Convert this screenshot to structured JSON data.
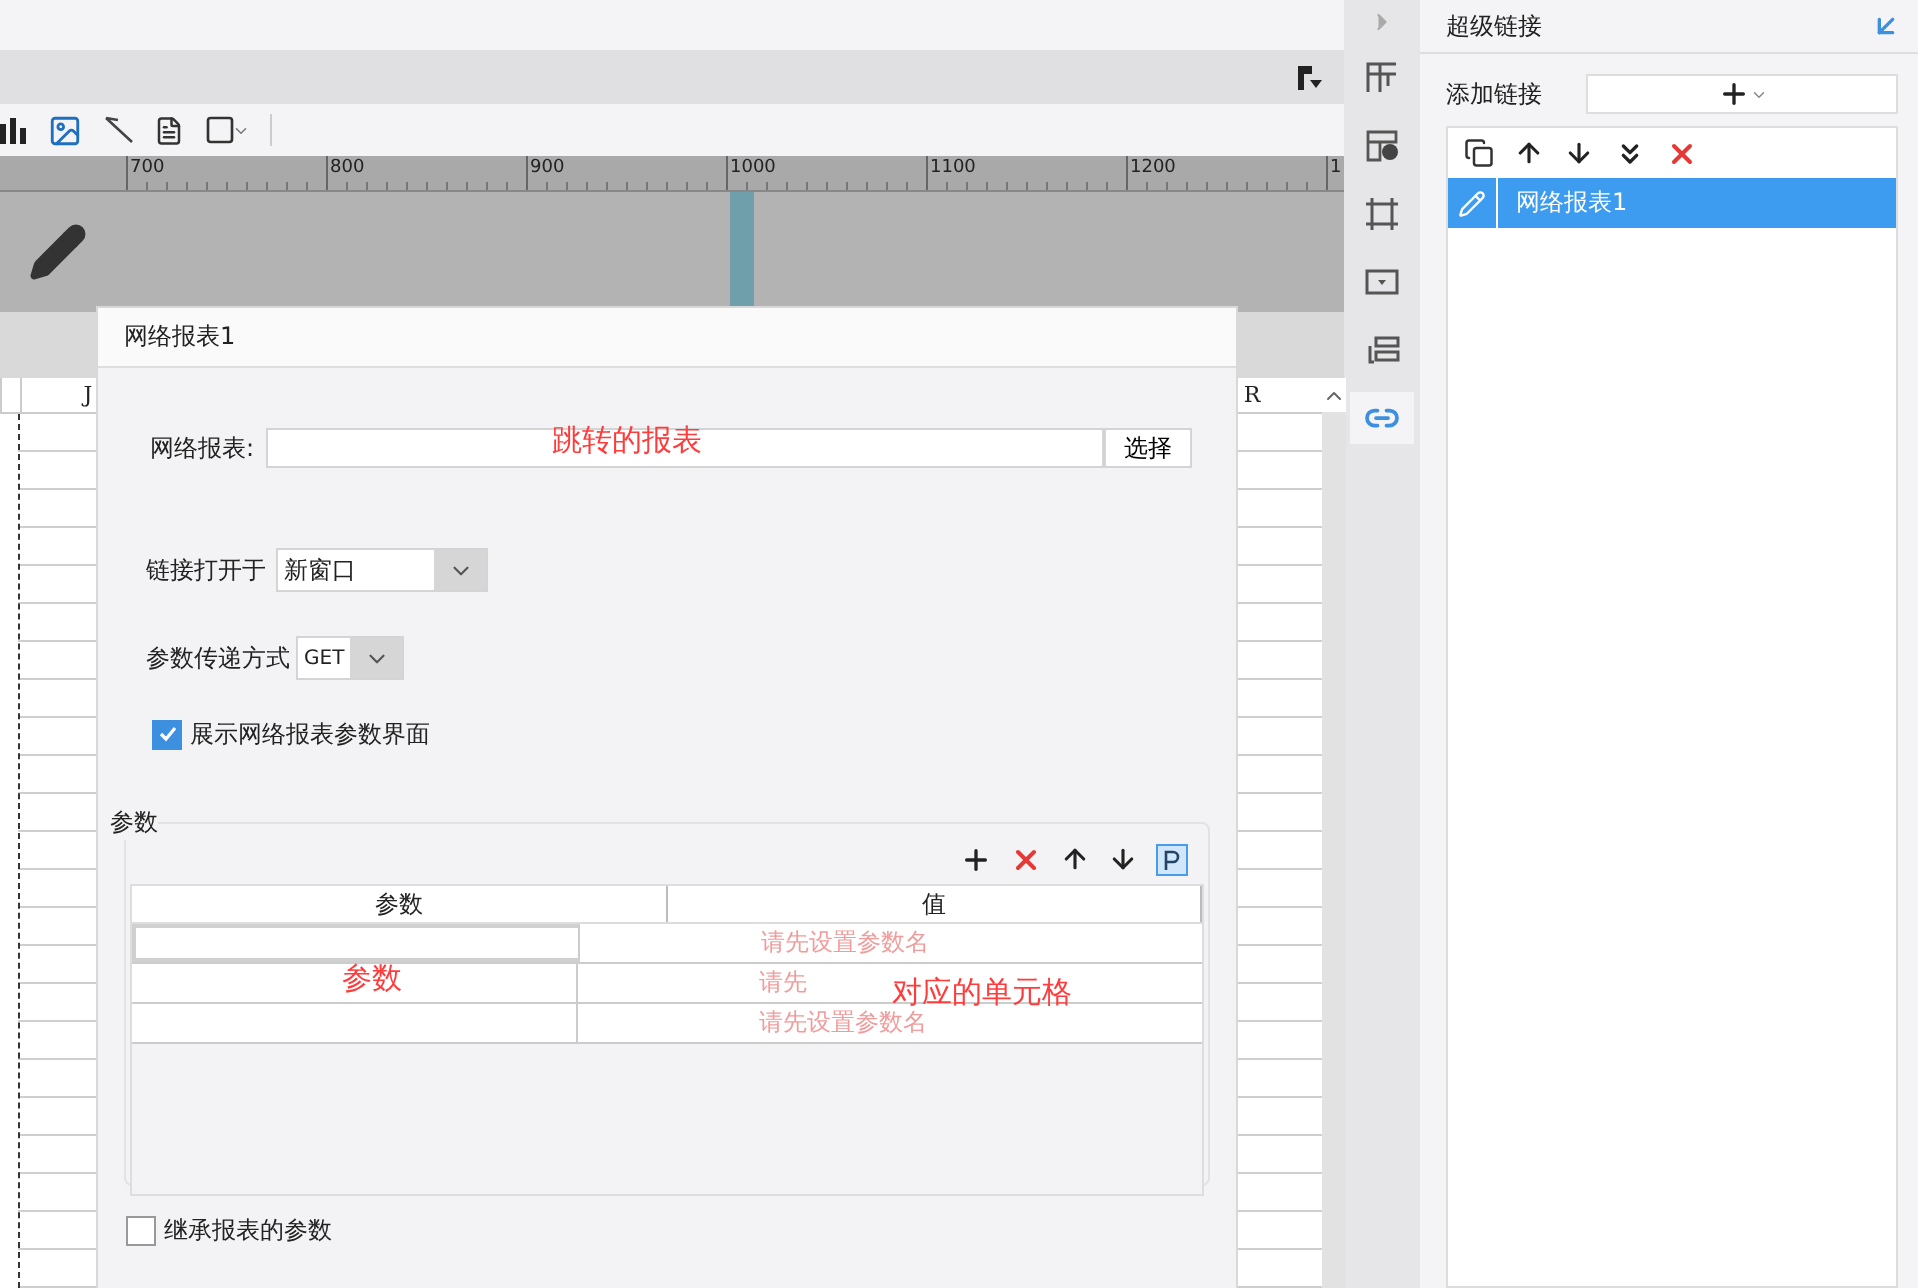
{
  "ruler": {
    "marks": [
      "700",
      "800",
      "900",
      "1000",
      "1100",
      "1200",
      "1"
    ]
  },
  "sheet": {
    "columns": [
      "J",
      "R"
    ]
  },
  "dialog": {
    "title": "网络报表1",
    "report": {
      "label": "网络报表:",
      "button": "选择"
    },
    "open_in": {
      "label": "链接打开于",
      "value": "新窗口"
    },
    "method": {
      "label": "参数传递方式",
      "value": "GET"
    },
    "show_params": {
      "label": "展示网络报表参数界面",
      "checked": true
    },
    "params": {
      "title": "参数",
      "columns": [
        "参数",
        "值"
      ],
      "rows": [
        {
          "placeholder": "请先设置参数名",
          "selected": true
        },
        {
          "placeholder": "请先",
          "selected": false
        },
        {
          "placeholder": "请先设置参数名",
          "selected": false
        }
      ]
    },
    "inherit": {
      "label": "继承报表的参数",
      "checked": false
    }
  },
  "annotations": [
    {
      "text": "跳转的报表"
    },
    {
      "text": "参数"
    },
    {
      "text": "对应的单元格"
    }
  ],
  "side_tabs": [
    {
      "selected": false
    },
    {
      "selected": false
    },
    {
      "selected": false
    },
    {
      "selected": false
    },
    {
      "selected": false
    },
    {
      "selected": true
    }
  ],
  "panel": {
    "title": "超级链接",
    "add_label": "添加链接",
    "links": [
      {
        "name": "网络报表1",
        "selected": true
      }
    ]
  }
}
